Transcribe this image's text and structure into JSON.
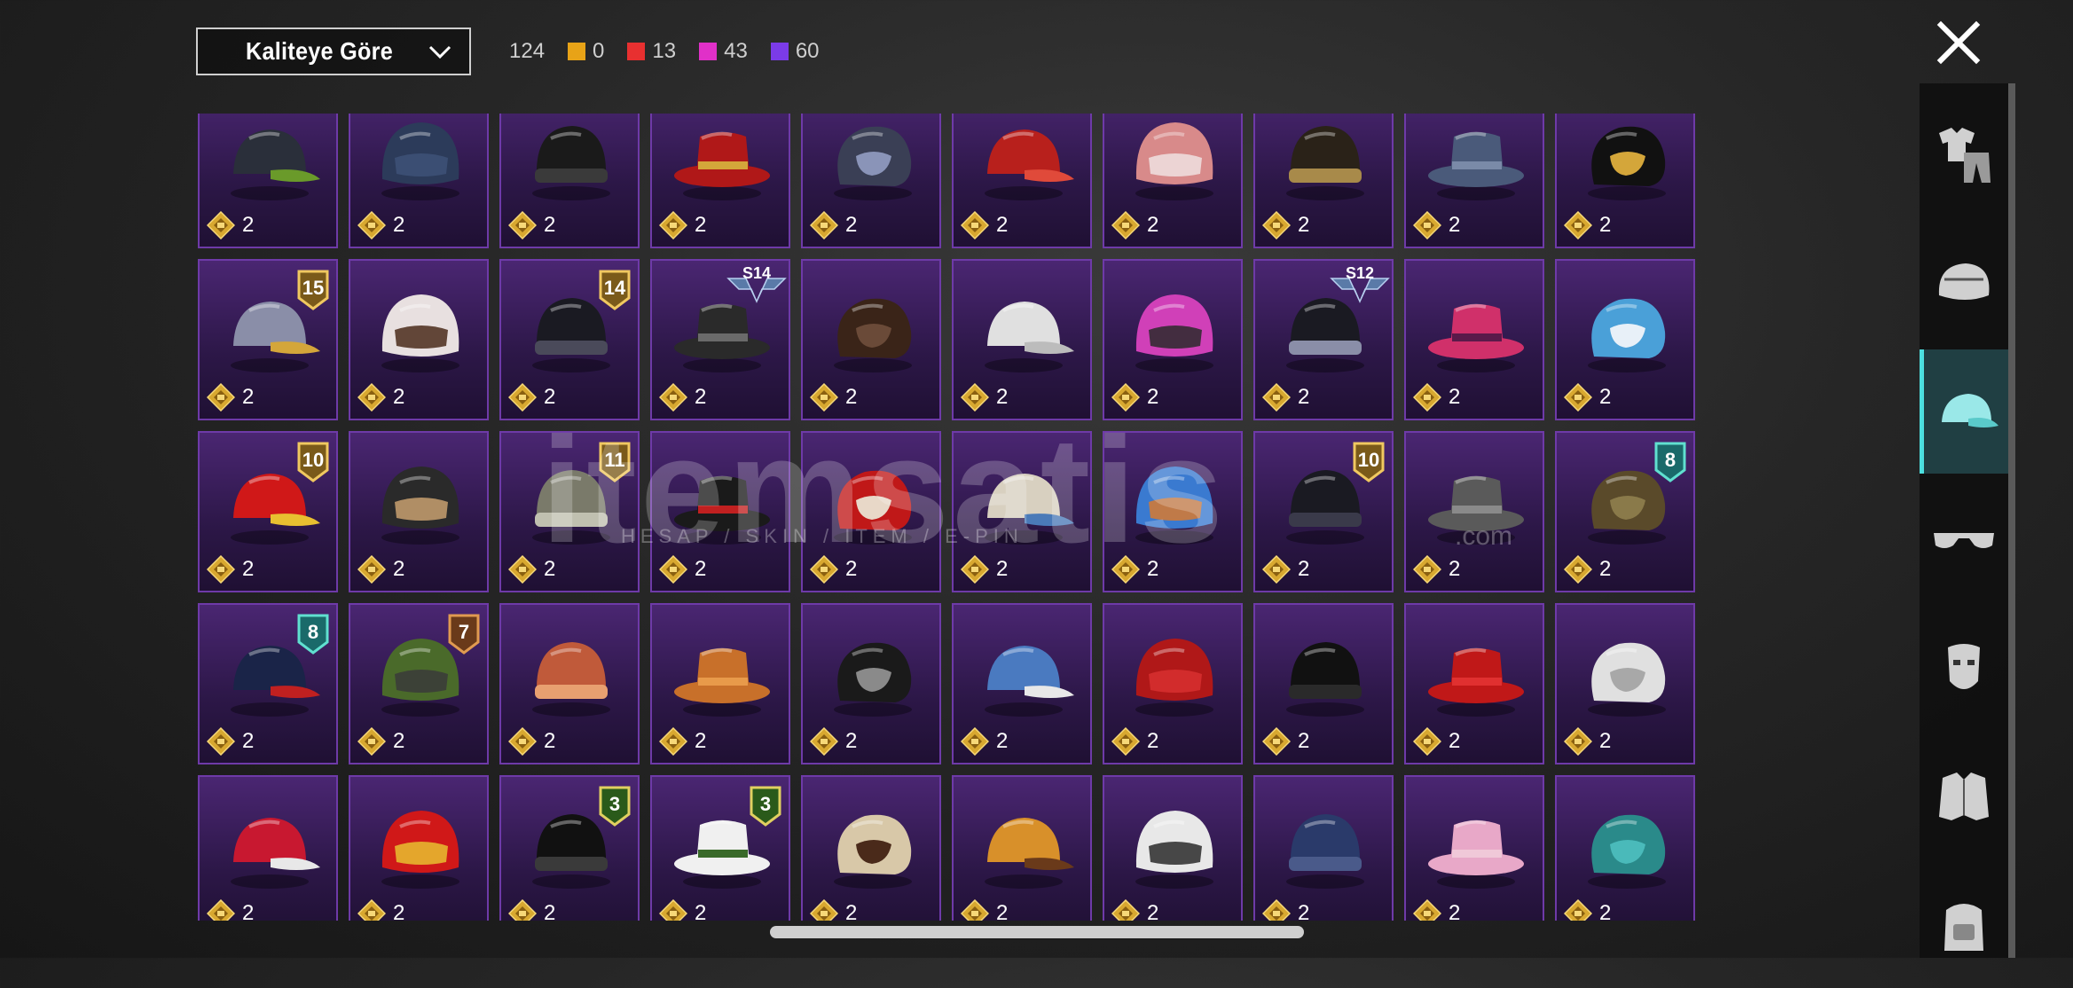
{
  "filter": {
    "sort_label": "Kaliteye Göre"
  },
  "summary": {
    "total": "124",
    "tiers": [
      {
        "color": "#e8a317",
        "count": "0"
      },
      {
        "color": "#e83030",
        "count": "13"
      },
      {
        "color": "#e030c8",
        "count": "43"
      },
      {
        "color": "#7b3be8",
        "count": "60"
      }
    ]
  },
  "watermark": {
    "brand": "itemsatis",
    "tagline": "HESAP / SKIN / ITEM / E-PIN",
    "suffix": ".com"
  },
  "rail": {
    "items": [
      {
        "icon": "outfit-icon",
        "active": false
      },
      {
        "icon": "helmet-icon",
        "active": false
      },
      {
        "icon": "cap-icon",
        "active": true
      },
      {
        "icon": "glasses-icon",
        "active": false
      },
      {
        "icon": "mask-icon",
        "active": false
      },
      {
        "icon": "jacket-icon",
        "active": false
      },
      {
        "icon": "backpack-icon",
        "active": false
      }
    ]
  },
  "grid": {
    "items": [
      {
        "icon": "gas-mask-helmet-icon",
        "qty": "2",
        "colors": [
          "#2a2f3a",
          "#6a9a2a"
        ],
        "badge": ""
      },
      {
        "icon": "navy-beanie-icon",
        "qty": "2",
        "colors": [
          "#2c3b5a",
          "#3e5278"
        ],
        "badge": ""
      },
      {
        "icon": "black-leather-cap-icon",
        "qty": "2",
        "colors": [
          "#1a1a1a",
          "#3a3a3a"
        ],
        "badge": ""
      },
      {
        "icon": "gold-red-cap-icon",
        "qty": "2",
        "colors": [
          "#b01818",
          "#d4a63a"
        ],
        "badge": ""
      },
      {
        "icon": "horned-helmet-icon",
        "qty": "2",
        "colors": [
          "#3a3f55",
          "#8a94b8"
        ],
        "badge": ""
      },
      {
        "icon": "red-fez-icon",
        "qty": "2",
        "colors": [
          "#b8201c",
          "#e04a3a"
        ],
        "badge": ""
      },
      {
        "icon": "striped-beanie-icon",
        "qty": "2",
        "colors": [
          "#d88a8a",
          "#f0e0e0"
        ],
        "badge": ""
      },
      {
        "icon": "steampunk-hat-icon",
        "qty": "2",
        "colors": [
          "#2a2218",
          "#a88a4a"
        ],
        "badge": ""
      },
      {
        "icon": "blue-cap-icon",
        "qty": "2",
        "colors": [
          "#4a5a7a",
          "#7a8aa8"
        ],
        "badge": ""
      },
      {
        "icon": "black-gold-fedora-icon",
        "qty": "2",
        "colors": [
          "#111111",
          "#d4a63a"
        ],
        "badge": ""
      },
      {
        "icon": "knight-helmet-icon",
        "qty": "2",
        "colors": [
          "#8a8ea8",
          "#d4a63a"
        ],
        "badge": "15"
      },
      {
        "icon": "clown-mask-icon",
        "qty": "2",
        "colors": [
          "#e8e0e0",
          "#4a2a1a"
        ],
        "badge": ""
      },
      {
        "icon": "police-cap-icon",
        "qty": "2",
        "colors": [
          "#1a1a22",
          "#4a4a5a"
        ],
        "badge": "14"
      },
      {
        "icon": "spartan-helmet-icon",
        "qty": "2",
        "colors": [
          "#2a2a2a",
          "#6a6a6a"
        ],
        "badge": "",
        "season": "S14"
      },
      {
        "icon": "brown-top-hat-icon",
        "qty": "2",
        "colors": [
          "#3a2418",
          "#6a4a38"
        ],
        "badge": ""
      },
      {
        "icon": "white-turban-icon",
        "qty": "2",
        "colors": [
          "#e0e0e0",
          "#bcbcbc"
        ],
        "badge": ""
      },
      {
        "icon": "pink-spiked-helmet-icon",
        "qty": "2",
        "colors": [
          "#d040b8",
          "#2a2a2a"
        ],
        "badge": ""
      },
      {
        "icon": "space-helmet-icon",
        "qty": "2",
        "colors": [
          "#1a1a22",
          "#8a8ea8"
        ],
        "badge": "",
        "season": "S12"
      },
      {
        "icon": "pink-moto-helmet-icon",
        "qty": "2",
        "colors": [
          "#d0306a",
          "#5a1a4a"
        ],
        "badge": ""
      },
      {
        "icon": "blue-pearl-hat-icon",
        "qty": "2",
        "colors": [
          "#4aa0d8",
          "#e8f0f8"
        ],
        "badge": ""
      },
      {
        "icon": "red-cap-icon",
        "qty": "2",
        "colors": [
          "#d01818",
          "#e8c030"
        ],
        "badge": "10"
      },
      {
        "icon": "wool-beanie-icon",
        "qty": "2",
        "colors": [
          "#2a2a2a",
          "#c8a070"
        ],
        "badge": ""
      },
      {
        "icon": "camo-boonie-icon",
        "qty": "2",
        "colors": [
          "#7a7a6a",
          "#c0c0b0"
        ],
        "badge": "11"
      },
      {
        "icon": "black-cap-icon",
        "qty": "2",
        "colors": [
          "#1a1a1a",
          "#c02020"
        ],
        "badge": ""
      },
      {
        "icon": "red-feather-hat-icon",
        "qty": "2",
        "colors": [
          "#c01818",
          "#e8d8c8"
        ],
        "badge": ""
      },
      {
        "icon": "patterned-turban-icon",
        "qty": "2",
        "colors": [
          "#d8d0c0",
          "#4a7ab8"
        ],
        "badge": ""
      },
      {
        "icon": "blue-orange-turban-icon",
        "qty": "2",
        "colors": [
          "#3a7ad0",
          "#d87a30"
        ],
        "badge": ""
      },
      {
        "icon": "dark-bowler-icon",
        "qty": "2",
        "colors": [
          "#1a1a22",
          "#3a3a4a"
        ],
        "badge": "10"
      },
      {
        "icon": "grey-bucket-hat-icon",
        "qty": "2",
        "colors": [
          "#5a5a5a",
          "#8a8a8a"
        ],
        "badge": ""
      },
      {
        "icon": "camo-bucket-hat-icon",
        "qty": "2",
        "colors": [
          "#5a4a2a",
          "#8a7a4a"
        ],
        "badge": "8"
      },
      {
        "icon": "navy-beret-icon",
        "qty": "2",
        "colors": [
          "#1a2448",
          "#c02020"
        ],
        "badge": "8"
      },
      {
        "icon": "pilot-helmet-icon",
        "qty": "2",
        "colors": [
          "#4a6a2a",
          "#3a3a3a"
        ],
        "badge": "7"
      },
      {
        "icon": "bandana-icon",
        "qty": "2",
        "colors": [
          "#c05a3a",
          "#e8a070"
        ],
        "badge": ""
      },
      {
        "icon": "orange-beanie-icon",
        "qty": "2",
        "colors": [
          "#c8702a",
          "#e89a4a"
        ],
        "badge": ""
      },
      {
        "icon": "luchador-mask-icon",
        "qty": "2",
        "colors": [
          "#1a1a1a",
          "#8a8a8a"
        ],
        "badge": ""
      },
      {
        "icon": "shark-hat-icon",
        "qty": "2",
        "colors": [
          "#4a7ac0",
          "#e8e8e8"
        ],
        "badge": ""
      },
      {
        "icon": "red-beret-icon",
        "qty": "2",
        "colors": [
          "#b01818",
          "#d83030"
        ],
        "badge": ""
      },
      {
        "icon": "black-top-hat-icon",
        "qty": "2",
        "colors": [
          "#111111",
          "#2a2a2a"
        ],
        "badge": ""
      },
      {
        "icon": "red-fedora-icon",
        "qty": "2",
        "colors": [
          "#c01818",
          "#e03030"
        ],
        "badge": ""
      },
      {
        "icon": "white-shark-hat-icon",
        "qty": "2",
        "colors": [
          "#e0e0e0",
          "#a8a8a8"
        ],
        "badge": ""
      },
      {
        "icon": "red-baseball-cap-icon",
        "qty": "2",
        "colors": [
          "#c81830",
          "#e8e8e8"
        ],
        "badge": ""
      },
      {
        "icon": "red-bucket-hat-icon",
        "qty": "2",
        "colors": [
          "#d01818",
          "#e8c030"
        ],
        "badge": ""
      },
      {
        "icon": "black-fedora-icon",
        "qty": "2",
        "colors": [
          "#111111",
          "#3a3a3a"
        ],
        "badge": "3"
      },
      {
        "icon": "flower-crown-icon",
        "qty": "2",
        "colors": [
          "#f0f0f0",
          "#3a6a2a"
        ],
        "badge": "3"
      },
      {
        "icon": "cake-hat-icon",
        "qty": "2",
        "colors": [
          "#d8c8a8",
          "#4a2a1a"
        ],
        "badge": ""
      },
      {
        "icon": "burger-hat-icon",
        "qty": "2",
        "colors": [
          "#d8902a",
          "#6a3a1a"
        ],
        "badge": ""
      },
      {
        "icon": "headlamp-icon",
        "qty": "2",
        "colors": [
          "#e8e8e8",
          "#2a2a2a"
        ],
        "badge": ""
      },
      {
        "icon": "sailor-hat-icon",
        "qty": "2",
        "colors": [
          "#2a3a6a",
          "#4a5a8a"
        ],
        "badge": ""
      },
      {
        "icon": "pink-cap-icon",
        "qty": "2",
        "colors": [
          "#e8a8c8",
          "#f0c8d8"
        ],
        "badge": ""
      },
      {
        "icon": "teal-beanie-icon",
        "qty": "2",
        "colors": [
          "#2a8a8a",
          "#4ababa"
        ],
        "badge": ""
      }
    ]
  }
}
